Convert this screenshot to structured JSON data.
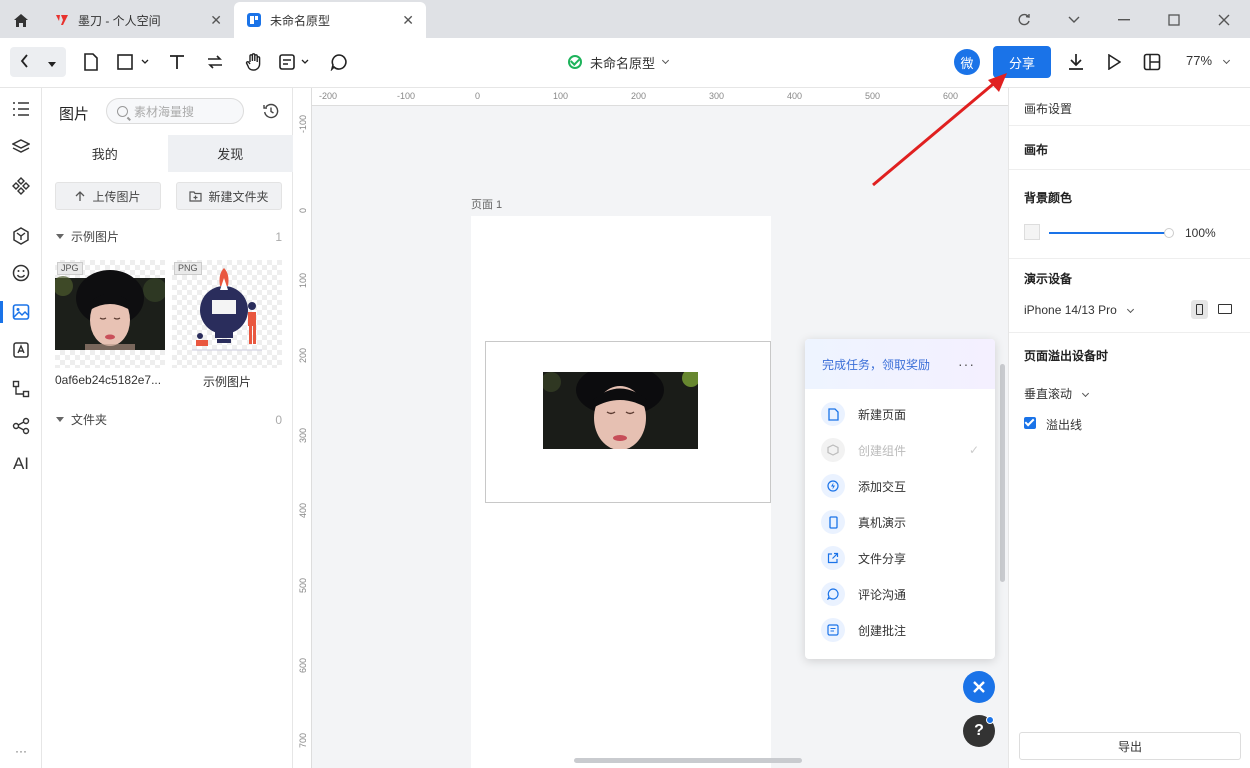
{
  "tabs": [
    {
      "title": "墨刀 - 个人空间"
    },
    {
      "title": "未命名原型"
    }
  ],
  "toolbar": {
    "doc_title": "未命名原型",
    "wei_label": "微",
    "share_label": "分享",
    "zoom": "77%"
  },
  "left_panel": {
    "title": "图片",
    "search_placeholder": "素材海量搜",
    "tab_mine": "我的",
    "tab_discover": "发现",
    "upload_label": "上传图片",
    "new_folder_label": "新建文件夹",
    "section_examples": "示例图片",
    "section_examples_count": "1",
    "images": [
      {
        "badge": "JPG",
        "caption": "0af6eb24c5182e7..."
      },
      {
        "badge": "PNG",
        "caption": "示例图片"
      }
    ],
    "section_folders": "文件夹",
    "section_folders_count": "0"
  },
  "rail": {
    "ai_label": "AI",
    "more_label": "···"
  },
  "canvas": {
    "page_label": "页面 1",
    "ruler_h": [
      "-200",
      "-100",
      "0",
      "100",
      "200",
      "300",
      "400",
      "500",
      "600"
    ],
    "ruler_v": [
      "-100",
      "0",
      "100",
      "200",
      "300",
      "400",
      "500",
      "600",
      "700"
    ]
  },
  "task_popover": {
    "header": "完成任务，领取奖励",
    "more": "···",
    "items": [
      {
        "label": "新建页面",
        "done": false
      },
      {
        "label": "创建组件",
        "done": true
      },
      {
        "label": "添加交互",
        "done": false
      },
      {
        "label": "真机演示",
        "done": false
      },
      {
        "label": "文件分享",
        "done": false
      },
      {
        "label": "评论沟通",
        "done": false
      },
      {
        "label": "创建批注",
        "done": false
      }
    ]
  },
  "right_panel": {
    "canvas_settings": "画布设置",
    "canvas": "画布",
    "bg_color": "背景颜色",
    "bg_opacity": "100%",
    "demo_device": "演示设备",
    "device_name": "iPhone 14/13 Pro",
    "overflow_title": "页面溢出设备时",
    "overflow_mode": "垂直滚动",
    "overflow_line": "溢出线",
    "export_label": "导出"
  },
  "colors": {
    "accent": "#1a73e8",
    "arrow": "#e02020"
  }
}
